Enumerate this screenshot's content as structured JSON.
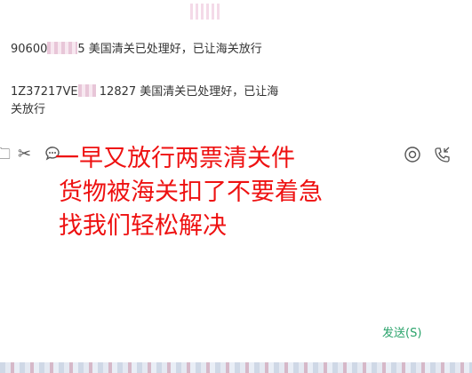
{
  "chat": {
    "messages": [
      {
        "prefix": "90600",
        "suffix": "5 美国清关已处理好，已让海关放行"
      },
      {
        "prefix": "1Z37217VE",
        "suffix": "12827 美国清关已处理好，已让海关放行"
      }
    ]
  },
  "toolbar": {
    "icons": [
      "folder-icon",
      "scissors-icon",
      "chat-bubble-icon",
      "target-icon",
      "phone-icon"
    ],
    "scissors_glyph": "✂",
    "chat_glyph": "💬",
    "folder_glyph": "🗀",
    "target_glyph": "◎",
    "phone_glyph": "✆"
  },
  "overlay_text": {
    "line1": "一早又放行两票清关件",
    "line2": "货物被海关扣了不要着急",
    "line3": "找我们轻松解决",
    "color": "#ee1111"
  },
  "send_button": {
    "label": "发送(S)",
    "color": "#2aa36b"
  }
}
